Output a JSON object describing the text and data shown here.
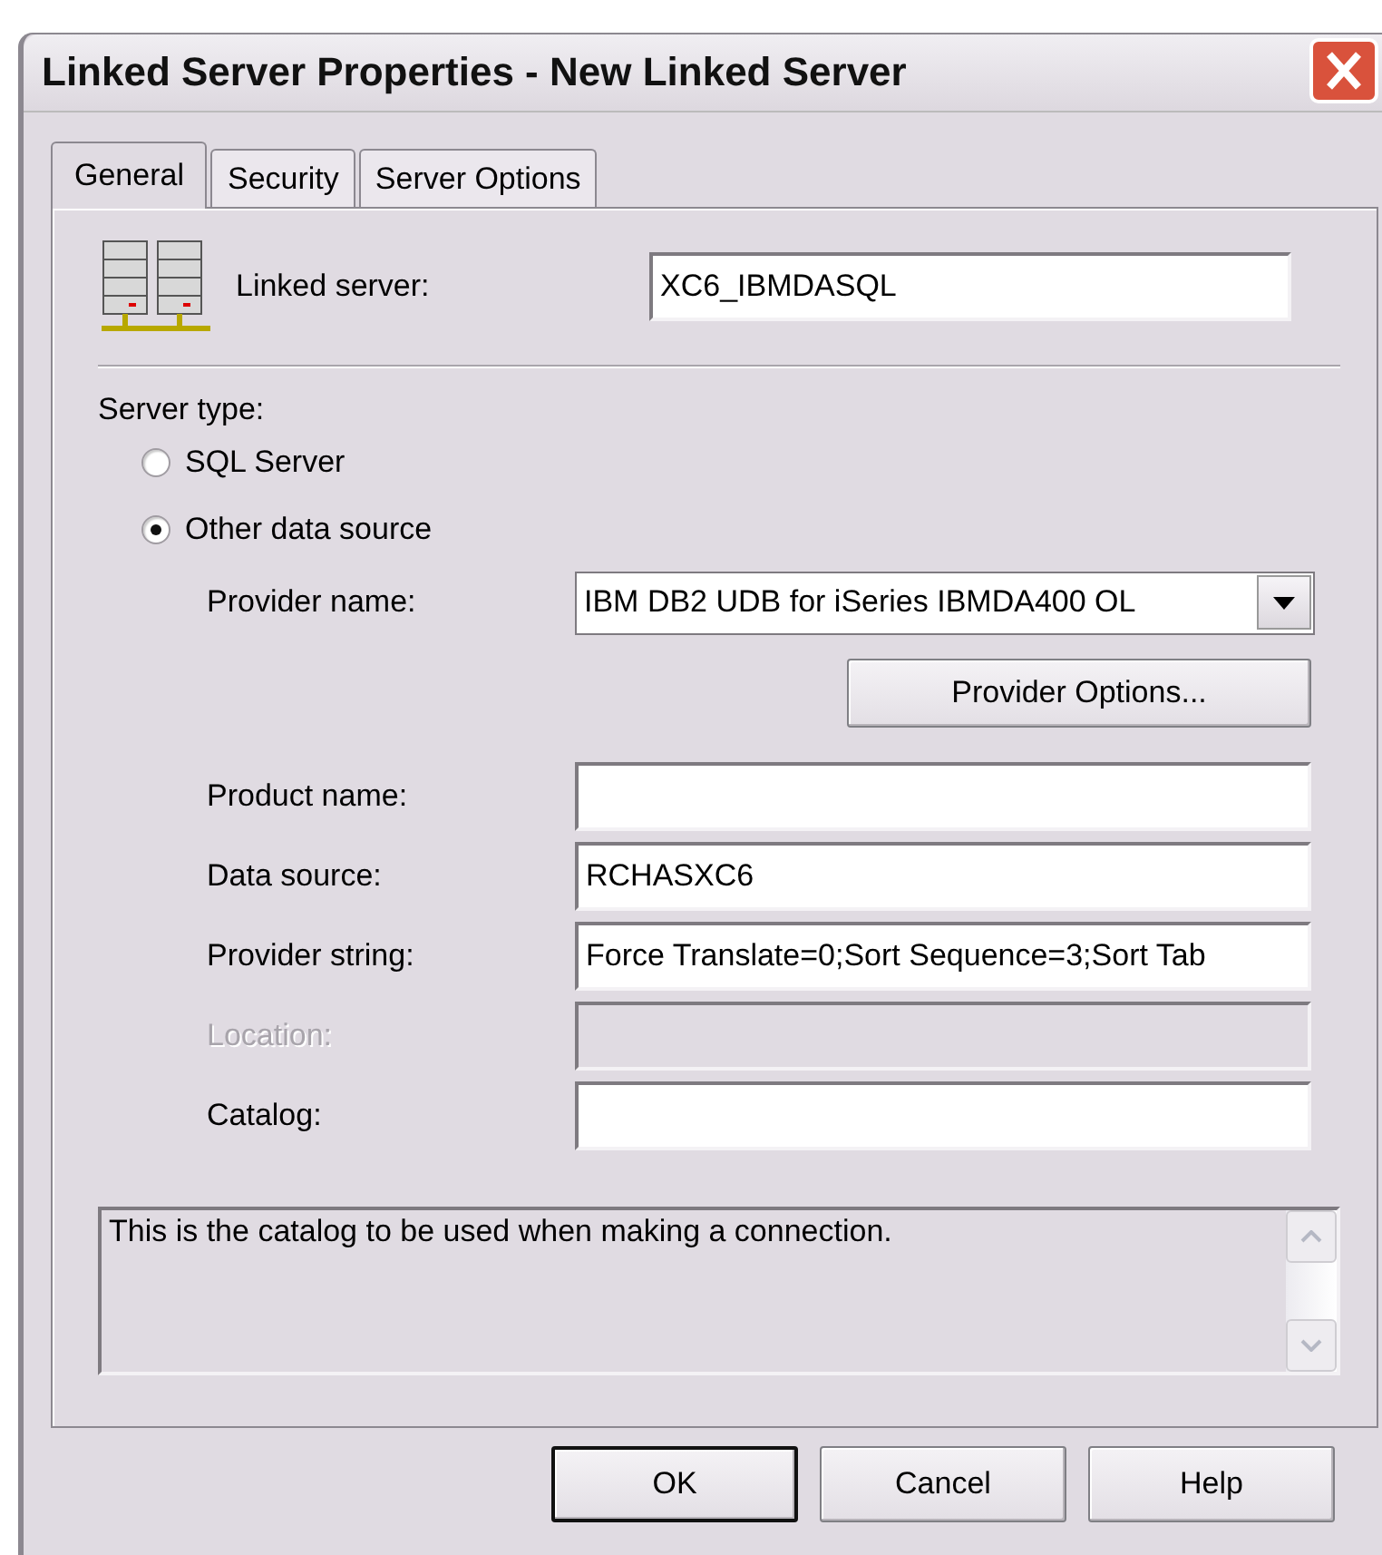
{
  "window": {
    "title": "Linked Server Properties - New Linked Server"
  },
  "tabs": [
    {
      "label": "General",
      "selected": true
    },
    {
      "label": "Security",
      "selected": false
    },
    {
      "label": "Server Options",
      "selected": false
    }
  ],
  "linked_server": {
    "label": "Linked server:",
    "value": "XC6_IBMDASQL"
  },
  "server_type": {
    "label": "Server type:",
    "options": [
      {
        "label": "SQL Server",
        "selected": false
      },
      {
        "label": "Other data source",
        "selected": true
      }
    ]
  },
  "provider_name": {
    "label": "Provider name:",
    "value": "IBM DB2 UDB for iSeries IBMDA400 OL"
  },
  "provider_options_button": "Provider Options...",
  "fields": [
    {
      "label": "Product name:",
      "disabled": false
    },
    {
      "label": "Data source:",
      "value": "RCHASXC6",
      "disabled": false
    },
    {
      "label": "Provider string:",
      "value": "Force Translate=0;Sort Sequence=3;Sort Tab",
      "disabled": false
    },
    {
      "label": "Location:",
      "disabled": true
    },
    {
      "label": "Catalog:",
      "disabled": false
    }
  ],
  "description": "This is the catalog to be used when making a connection.",
  "buttons": [
    {
      "label": "OK",
      "default": true
    },
    {
      "label": "Cancel",
      "default": false
    },
    {
      "label": "Help",
      "default": false
    }
  ]
}
